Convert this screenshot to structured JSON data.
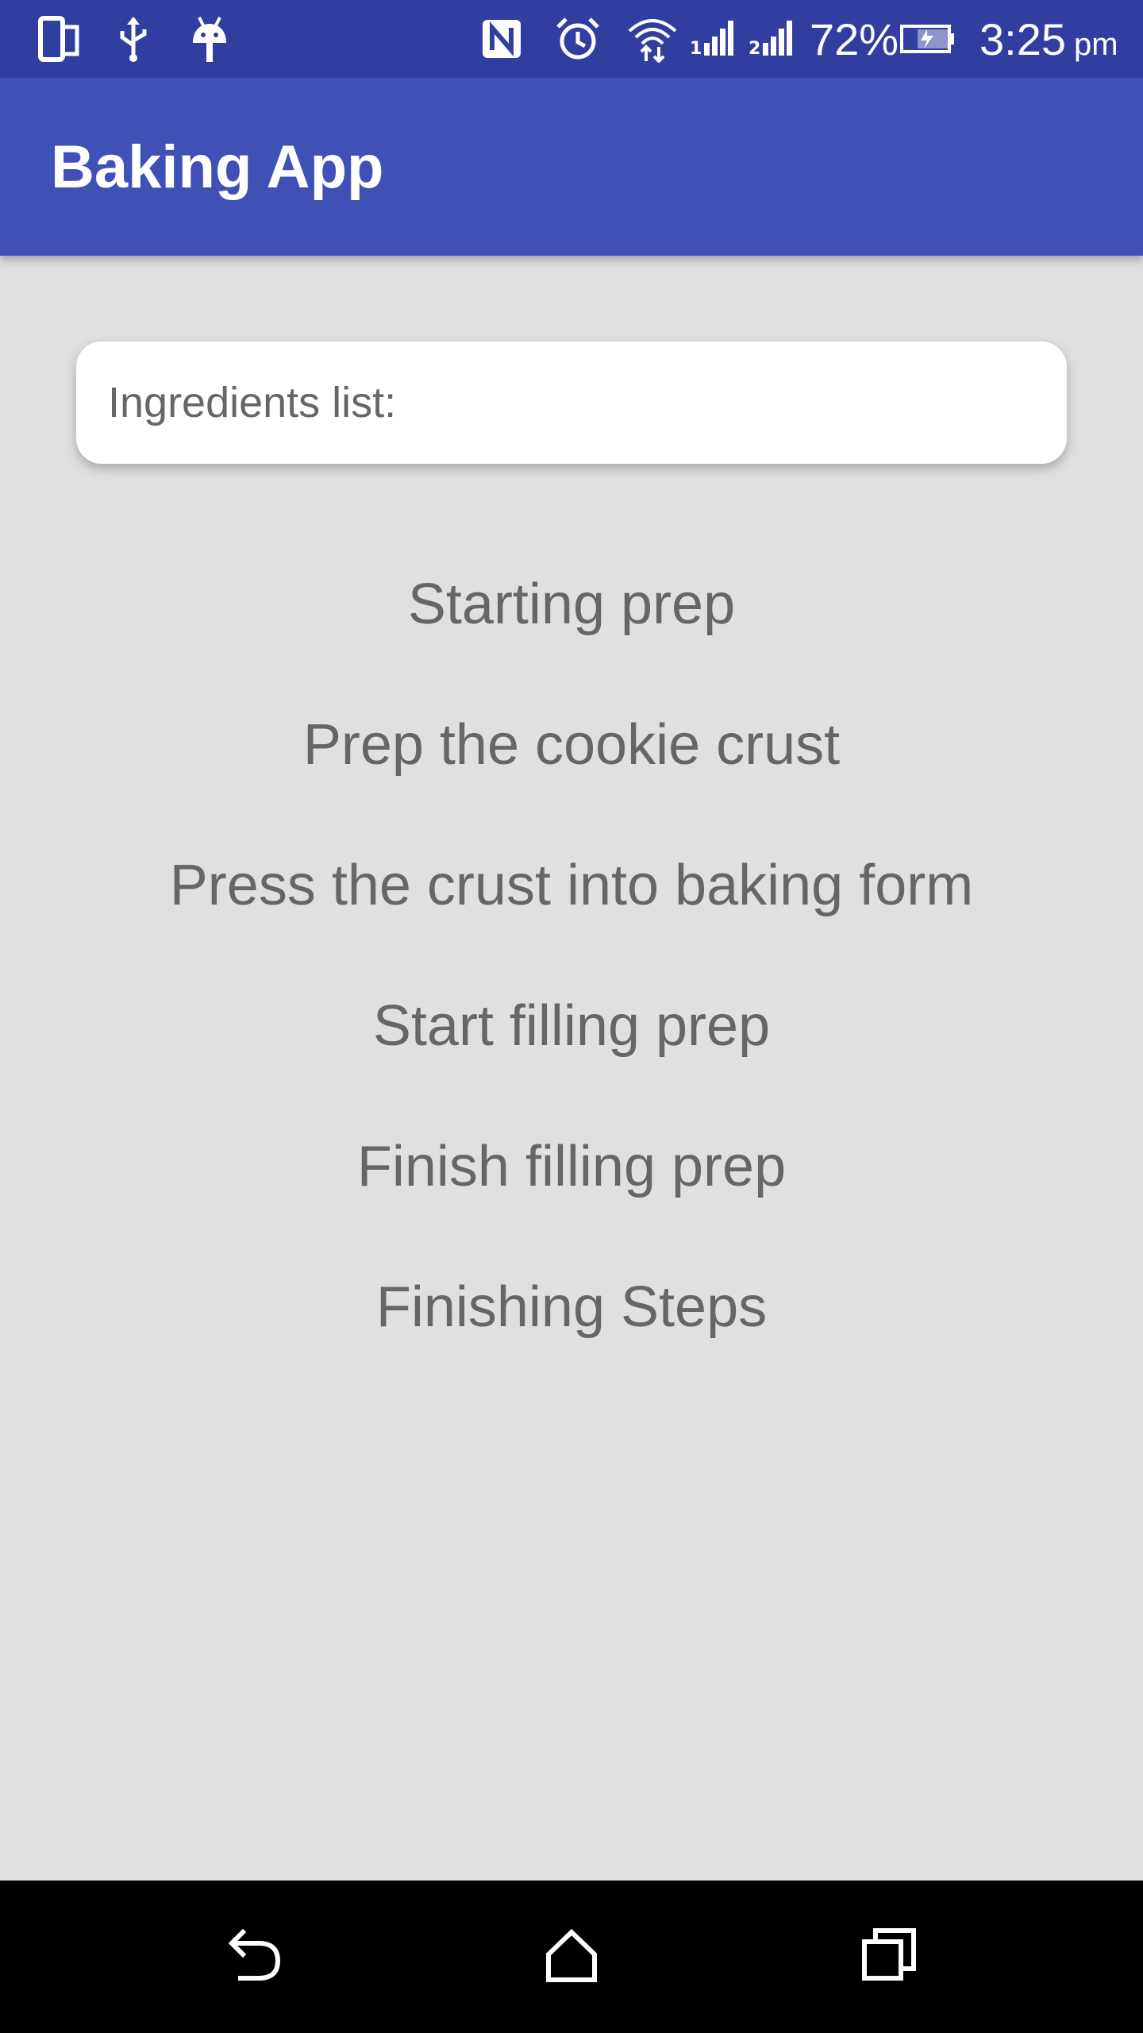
{
  "status_bar": {
    "battery": "72%",
    "time": "3:25",
    "ampm": "pm",
    "icons": [
      "dual-screen-icon",
      "usb-icon",
      "android-icon",
      "nfc-icon",
      "alarm-icon",
      "wifi-icon",
      "signal-1-icon",
      "signal-2-icon",
      "battery-charging-icon"
    ]
  },
  "app_bar": {
    "title": "Baking App"
  },
  "ingredients": {
    "label": "Ingredients list:"
  },
  "steps": [
    {
      "label": "Starting prep"
    },
    {
      "label": "Prep the cookie crust"
    },
    {
      "label": "Press the crust into baking form"
    },
    {
      "label": "Start filling prep"
    },
    {
      "label": "Finish filling prep"
    },
    {
      "label": "Finishing Steps"
    }
  ],
  "nav_bar": {
    "icons": [
      "back-icon",
      "home-icon",
      "recents-icon"
    ]
  },
  "colors": {
    "status_bar": "#303f9f",
    "app_bar": "#3f51b5",
    "background": "#e0e0e0",
    "text_secondary": "#666666"
  }
}
